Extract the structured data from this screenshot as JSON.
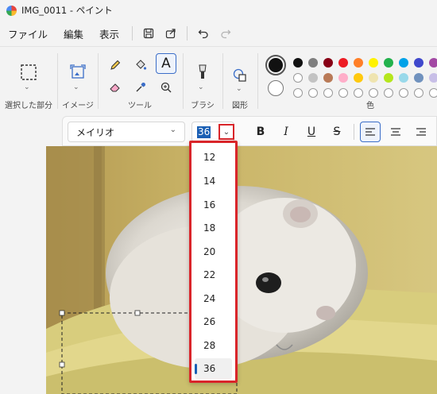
{
  "title": "IMG_0011 - ペイント",
  "menu": [
    "ファイル",
    "編集",
    "表示"
  ],
  "toolbar_icons": [
    "save-icon",
    "share-icon",
    "undo-icon",
    "redo-icon"
  ],
  "ribbon": {
    "selection_label": "選択した部分",
    "image_label": "イメージ",
    "tools_label": "ツール",
    "brush_label": "ブラシ",
    "shapes_label": "図形",
    "colors_label": "色",
    "text_tool_glyph": "A"
  },
  "colors": {
    "primary": "#111111",
    "secondary": "#ffffff",
    "palette_row1": [
      "#111111",
      "#7f7f7f",
      "#880015",
      "#ed1c24",
      "#ff7f27",
      "#fff200",
      "#22b14c",
      "#00a2e8",
      "#3f48cc",
      "#a349a4"
    ],
    "palette_row2": [
      "#ffffff",
      "#c3c3c3",
      "#b97a57",
      "#ffaec9",
      "#ffc90e",
      "#efe4b0",
      "#b5e61d",
      "#99d9ea",
      "#7092be",
      "#c8bfe7"
    ]
  },
  "textbar": {
    "font_name": "メイリオ",
    "font_size": "36",
    "bold": "B",
    "italic": "I",
    "underline": "U",
    "strike": "S"
  },
  "size_options": [
    "12",
    "14",
    "16",
    "18",
    "20",
    "22",
    "24",
    "26",
    "28",
    "36"
  ],
  "selected_size": "36"
}
